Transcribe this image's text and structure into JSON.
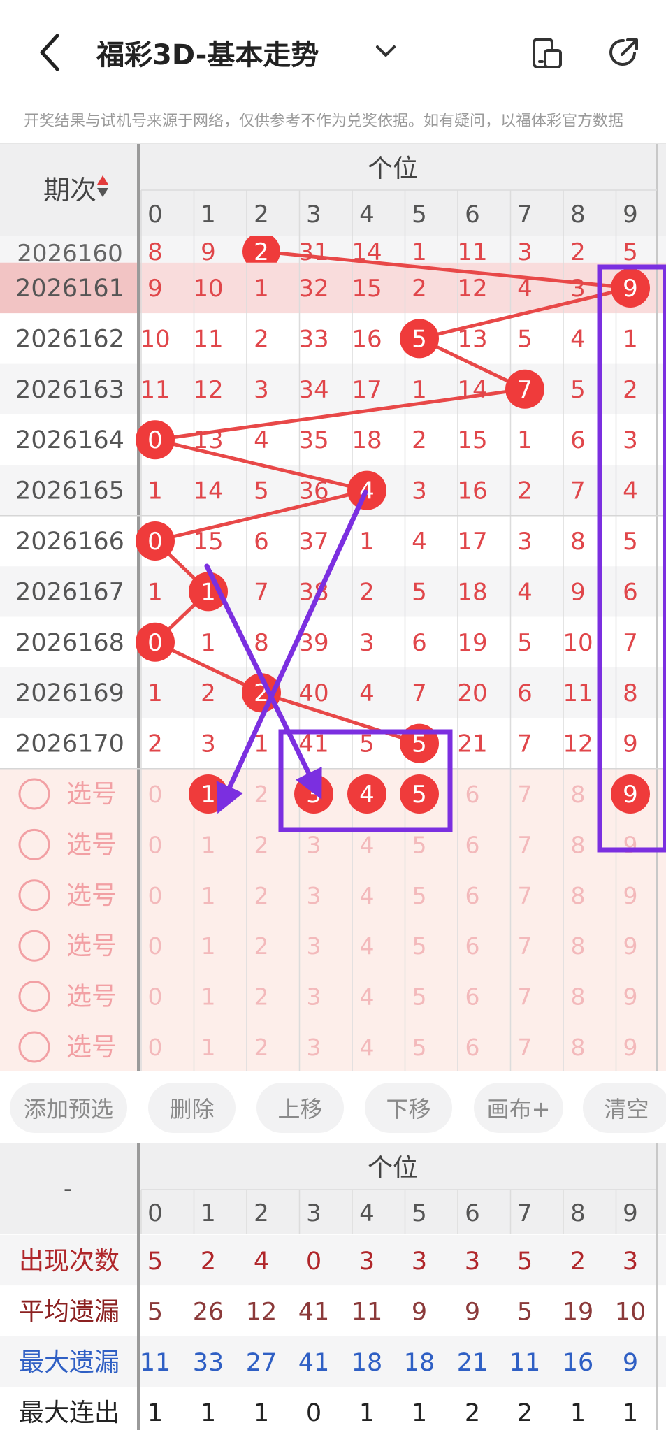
{
  "header": {
    "title": "福彩3D-基本走势",
    "notice": "开奖结果与试机号来源于网络，仅供参考不作为兑奖依据。如有疑问，以福体彩官方数据"
  },
  "table": {
    "issue_header": "期次",
    "group_header": "个位",
    "digit_headers": [
      "0",
      "1",
      "2",
      "3",
      "4",
      "5",
      "6",
      "7",
      "8",
      "9"
    ],
    "top_partial_row": {
      "issue": "2026160",
      "cells": [
        "8",
        "9",
        "2",
        "31",
        "14",
        "1",
        "11",
        "3",
        "2",
        "5"
      ]
    },
    "rows": [
      {
        "issue": "2026161",
        "cells": [
          "9",
          "10",
          "1",
          "32",
          "15",
          "2",
          "12",
          "4",
          "3",
          "9"
        ],
        "hit": 9
      },
      {
        "issue": "2026162",
        "cells": [
          "10",
          "11",
          "2",
          "33",
          "16",
          "5",
          "13",
          "5",
          "4",
          "1"
        ],
        "hit": 5
      },
      {
        "issue": "2026163",
        "cells": [
          "11",
          "12",
          "3",
          "34",
          "17",
          "1",
          "14",
          "7",
          "5",
          "2"
        ],
        "hit": 7
      },
      {
        "issue": "2026164",
        "cells": [
          "0",
          "13",
          "4",
          "35",
          "18",
          "2",
          "15",
          "1",
          "6",
          "3"
        ],
        "hit": 0
      },
      {
        "issue": "2026165",
        "cells": [
          "1",
          "14",
          "5",
          "36",
          "4",
          "3",
          "16",
          "2",
          "7",
          "4"
        ],
        "hit": 4
      },
      {
        "issue": "2026166",
        "cells": [
          "0",
          "15",
          "6",
          "37",
          "1",
          "4",
          "17",
          "3",
          "8",
          "5"
        ],
        "hit": 0
      },
      {
        "issue": "2026167",
        "cells": [
          "1",
          "1",
          "7",
          "38",
          "2",
          "5",
          "18",
          "4",
          "9",
          "6"
        ],
        "hit": 1
      },
      {
        "issue": "2026168",
        "cells": [
          "0",
          "1",
          "8",
          "39",
          "3",
          "6",
          "19",
          "5",
          "10",
          "7"
        ],
        "hit": 0
      },
      {
        "issue": "2026169",
        "cells": [
          "1",
          "2",
          "2",
          "40",
          "4",
          "7",
          "20",
          "6",
          "11",
          "8"
        ],
        "hit": 2
      },
      {
        "issue": "2026170",
        "cells": [
          "2",
          "3",
          "1",
          "41",
          "5",
          "5",
          "21",
          "7",
          "12",
          "9"
        ],
        "hit": 5
      }
    ],
    "select_label": "选号",
    "select_rows": [
      {
        "cells": [
          "0",
          "1",
          "2",
          "3",
          "4",
          "5",
          "6",
          "7",
          "8",
          "9"
        ],
        "selected": [
          1,
          3,
          4,
          5,
          9
        ]
      },
      {
        "cells": [
          "0",
          "1",
          "2",
          "3",
          "4",
          "5",
          "6",
          "7",
          "8",
          "9"
        ],
        "selected": []
      },
      {
        "cells": [
          "0",
          "1",
          "2",
          "3",
          "4",
          "5",
          "6",
          "7",
          "8",
          "9"
        ],
        "selected": []
      },
      {
        "cells": [
          "0",
          "1",
          "2",
          "3",
          "4",
          "5",
          "6",
          "7",
          "8",
          "9"
        ],
        "selected": []
      },
      {
        "cells": [
          "0",
          "1",
          "2",
          "3",
          "4",
          "5",
          "6",
          "7",
          "8",
          "9"
        ],
        "selected": []
      },
      {
        "cells": [
          "0",
          "1",
          "2",
          "3",
          "4",
          "5",
          "6",
          "7",
          "8",
          "9"
        ],
        "selected": []
      }
    ]
  },
  "actions": [
    "添加预选",
    "删除",
    "上移",
    "下移",
    "画布+",
    "清空"
  ],
  "stats": {
    "corner": "-",
    "group_header": "个位",
    "digit_headers": [
      "0",
      "1",
      "2",
      "3",
      "4",
      "5",
      "6",
      "7",
      "8",
      "9"
    ],
    "rows": [
      {
        "label": "出现次数",
        "values": [
          "5",
          "2",
          "4",
          "0",
          "3",
          "3",
          "3",
          "5",
          "2",
          "3"
        ],
        "label_color": "#b0262a",
        "value_color": "#b0262a"
      },
      {
        "label": "平均遗漏",
        "values": [
          "5",
          "26",
          "12",
          "41",
          "11",
          "9",
          "9",
          "5",
          "19",
          "10"
        ],
        "label_color": "#8b2020",
        "value_color": "#8b3a3a"
      },
      {
        "label": "最大遗漏",
        "values": [
          "11",
          "33",
          "27",
          "41",
          "18",
          "18",
          "21",
          "11",
          "16",
          "9"
        ],
        "label_color": "#2f5fc4",
        "value_color": "#2f5fc4"
      },
      {
        "label": "最大连出",
        "values": [
          "1",
          "1",
          "1",
          "0",
          "1",
          "1",
          "2",
          "2",
          "1",
          "1"
        ],
        "label_color": "#222222",
        "value_color": "#222222"
      }
    ]
  },
  "colors": {
    "hit_ball": "#ef3b3b",
    "trend_line": "#e84848",
    "annotation": "#7b2fe0",
    "cell_text": "#e0464a",
    "select_bg": "#fdeeea",
    "highlight_row": "#f9dcdc"
  }
}
